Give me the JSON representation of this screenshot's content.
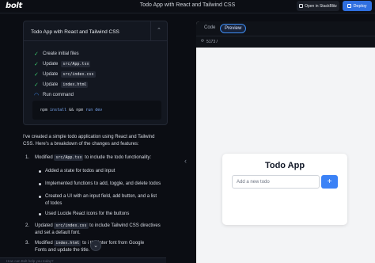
{
  "header": {
    "logo": "bolt",
    "title": "Todo App with React and Tailwind CSS",
    "open_stackblitz": "Open in StackBlitz",
    "deploy": "Deploy"
  },
  "artifact": {
    "title": "Todo App with React and Tailwind CSS",
    "steps": [
      {
        "text": "Create initial files",
        "code": "",
        "status": "done"
      },
      {
        "text": "Update",
        "code": "src/App.tsx",
        "status": "done"
      },
      {
        "text": "Update",
        "code": "src/index.css",
        "status": "done"
      },
      {
        "text": "Update",
        "code": "index.html",
        "status": "done"
      },
      {
        "text": "Run command",
        "code": "",
        "status": "running"
      }
    ],
    "command": {
      "kw1": "npm",
      "a1": "install",
      "op": "&&",
      "kw2": "npm",
      "a2": "run dev"
    }
  },
  "message": {
    "intro_l1": "I've created a simple todo application using React and Tailwind",
    "intro_l2": "CSS. Here's a breakdown of the changes and features:",
    "item1_pre": "Modified",
    "item1_code": "src/App.tsx",
    "item1_post": "to include the todo functionality:",
    "bullets": [
      "Added a state for todos and input",
      "Implemented functions to add, toggle, and delete todos",
      "Created a UI with an input field, add button, and a list",
      "of todos",
      "Used Lucide React icons for the buttons"
    ],
    "item2_pre": "Updated",
    "item2_code": "src/index.css",
    "item2_post": "to include Tailwind CSS directives",
    "item2_l2": "and set a default font.",
    "item3_pre": "Modified",
    "item3_code": "index.html",
    "item3_post": "to i      the Inter font from Google",
    "item3_l2": "Fonts and update the title.",
    "input_placeholder": "How can Bolt help you today?"
  },
  "preview": {
    "tab_code": "Code",
    "tab_preview": "Preview",
    "address": "5173  /",
    "app_title": "Todo App",
    "input_placeholder": "Add a new todo",
    "add_symbol": "+"
  }
}
